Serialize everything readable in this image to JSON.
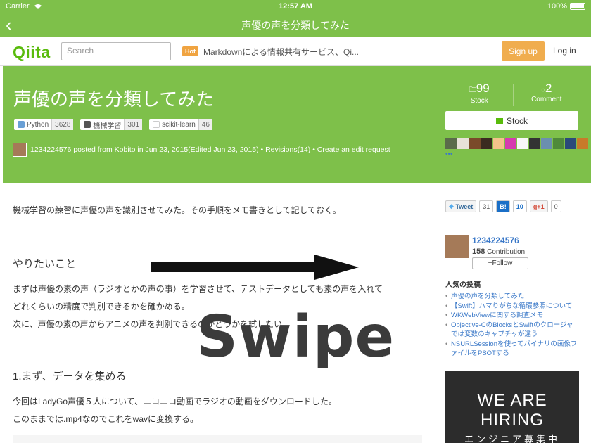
{
  "status_bar": {
    "carrier": "Carrier",
    "time": "12:57 AM",
    "battery": "100%"
  },
  "nav": {
    "title": "声優の声を分類してみた"
  },
  "header": {
    "logo": "Qiita",
    "search_placeholder": "Search",
    "hot_badge": "Hot",
    "hot_link": "Markdownによる情報共有サービス、Qi...",
    "signup": "Sign up",
    "login": "Log in"
  },
  "hero": {
    "title": "声優の声を分類してみた",
    "tags": [
      {
        "name": "Python",
        "count": "3628"
      },
      {
        "name": "機械学習",
        "count": "301"
      },
      {
        "name": "scikit-learn",
        "count": "46"
      }
    ],
    "meta": "1234224576 posted from Kobito in Jun 23, 2015(Edited Jun 23, 2015) • Revisions(14) • Create an edit request",
    "stock_count": "99",
    "stock_label": "Stock",
    "comment_count": "2",
    "comment_label": "Comment",
    "stock_button": "Stock",
    "more": "•••"
  },
  "article": {
    "intro": "機械学習の練習に声優の声を識別させてみた。その手順をメモ書きとして記しておく。",
    "h2_1": "やりたいこと",
    "p2_l1": "まずは声優の素の声（ラジオとかの声の事）を学習させて、テストデータとしても素の声を入れて",
    "p2_l2": "どれくらいの精度で判別できるかを確かめる。",
    "p2_l3": "次に、声優の素の声からアニメの声を判別できるのかどうかを試したい。",
    "h2_2": "1.まず、データを集める",
    "p3_l1": "今回はLadyGo声優５人について、ニコニコ動画でラジオの動画をダウンロードした。",
    "p3_l2": "このままでは.mp4なのでこれをwavに変換する。"
  },
  "sidebar": {
    "tweet": "Tweet",
    "tweet_count": "31",
    "hatena": "B!",
    "hatena_count": "10",
    "gplus": "g+1",
    "gplus_count": "0",
    "author_name": "1234224576",
    "contribution_num": "158",
    "contribution_label": "Contribution",
    "follow": "+Follow",
    "popular_title": "人気の投稿",
    "popular": [
      "声優の声を分類してみた",
      "【Swift】ハマりがちな循環参照について",
      "WKWebViewに関する調査メモ",
      "Objective-CのBlocksとSwiftのクロージャでは変数のキャプチャが違う",
      "NSURLSessionを使ってバイナリの画像ファイルをPSOTする"
    ],
    "hiring_title": "WE ARE HIRING",
    "hiring_sub": "エンジニア募集中"
  },
  "overlay": {
    "swipe": "Swipe"
  },
  "colors": {
    "brand_green": "#7ec04a",
    "qiita_logo": "#59bb0c",
    "signup": "#f0ad4e",
    "link": "#3a78c8"
  }
}
